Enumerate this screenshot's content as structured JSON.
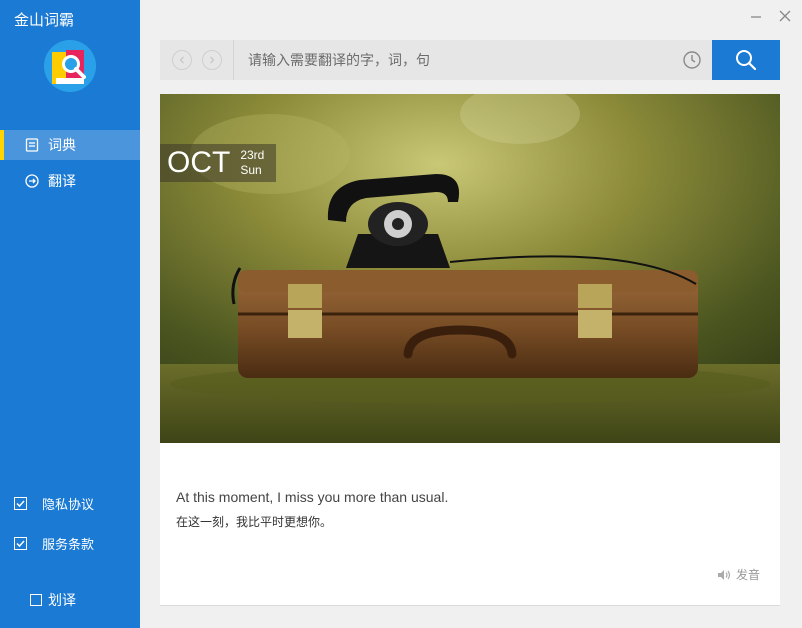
{
  "app": {
    "title": "金山词霸"
  },
  "sidebar": {
    "items": [
      {
        "label": "词典",
        "icon": "dictionary-icon",
        "active": true
      },
      {
        "label": "翻译",
        "icon": "translate-icon",
        "active": false
      }
    ],
    "checks": [
      {
        "label": "隐私协议",
        "checked": true
      },
      {
        "label": "服务条款",
        "checked": true
      }
    ],
    "scan_translate": {
      "label": "划译",
      "checked": false
    }
  },
  "search": {
    "placeholder": "请输入需要翻译的字，词，句",
    "value": ""
  },
  "daily": {
    "month": "OCT",
    "day": "23rd",
    "weekday": "Sun",
    "quote_en": "At this moment, I miss you more than usual.",
    "quote_zh": "在这一刻，我比平时更想你。",
    "speak_label": "发音"
  },
  "colors": {
    "sidebar": "#1a7ad4",
    "accent": "#1a7ad4",
    "active_marker": "#ffd400"
  }
}
